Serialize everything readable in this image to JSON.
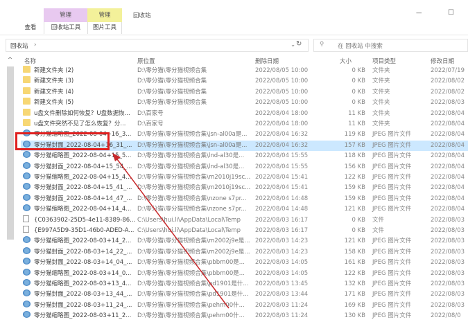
{
  "ribbon": {
    "context_tabs": [
      "管理",
      "管理"
    ],
    "window_title": "回收站",
    "tabs": [
      "查看",
      "回收站工具",
      "图片工具"
    ],
    "minimize": "—",
    "maximize": "☐"
  },
  "address": {
    "path": "回收站",
    "separator": "›",
    "search_placeholder": "在 回收站 中搜索"
  },
  "columns": [
    "名称",
    "原位置",
    "删除日期",
    "大小",
    "项目类型",
    "修改日期"
  ],
  "rows": [
    {
      "icon": "folder",
      "name": "新建文件夹 (2)",
      "loc": "D:\\零分猫\\零分猫视频合集",
      "del": "2022/08/05 10:00",
      "size": "0 KB",
      "type": "文件夹",
      "mod": "2022/07/19"
    },
    {
      "icon": "folder",
      "name": "新建文件夹 (3)",
      "loc": "D:\\零分猫\\零分猫视频合集",
      "del": "2022/08/05 10:00",
      "size": "0 KB",
      "type": "文件夹",
      "mod": "2022/08/02"
    },
    {
      "icon": "folder",
      "name": "新建文件夹 (4)",
      "loc": "D:\\零分猫\\零分猫视频合集",
      "del": "2022/08/05 10:00",
      "size": "0 KB",
      "type": "文件夹",
      "mod": "2022/08/02"
    },
    {
      "icon": "folder",
      "name": "新建文件夹 (5)",
      "loc": "D:\\零分猫\\零分猫视频合集",
      "del": "2022/08/05 10:00",
      "size": "0 KB",
      "type": "文件夹",
      "mod": "2022/08/03"
    },
    {
      "icon": "folder",
      "name": "u盘文件删除如何恢复？U盘数据恢...",
      "loc": "D:\\百家号",
      "del": "2022/08/04 18:00",
      "size": "11 KB",
      "type": "文件夹",
      "mod": "2022/08/04"
    },
    {
      "icon": "folder",
      "name": "u盘文件突然不见了怎么恢复？分...",
      "loc": "D:\\百家号",
      "del": "2022/08/04 18:00",
      "size": "11 KB",
      "type": "文件夹",
      "mod": "2022/08/04"
    },
    {
      "icon": "img",
      "name": "零分猫缩略图_2022-08-04+16_3...",
      "loc": "D:\\零分猫\\零分猫视频合集\\jsn-al00a是...",
      "del": "2022/08/04 16:32",
      "size": "119 KB",
      "type": "JPEG 图片文件",
      "mod": "2022/08/04"
    },
    {
      "icon": "img",
      "name": "零分猫封面_2022-08-04+16_31_...",
      "loc": "D:\\零分猫\\零分猫视频合集\\jsn-al00a是...",
      "del": "2022/08/04 16:32",
      "size": "157 KB",
      "type": "JPEG 图片文件",
      "mod": "2022/08/04"
    },
    {
      "icon": "img",
      "name": "零分猫缩略图_2022-08-04+15_5...",
      "loc": "D:\\零分猫\\零分猫视频合集\\lnd-al30是...",
      "del": "2022/08/04 15:55",
      "size": "118 KB",
      "type": "JPEG 图片文件",
      "mod": "2022/08/04"
    },
    {
      "icon": "img",
      "name": "零分猫封面_2022-08-04+15_54_...",
      "loc": "D:\\零分猫\\零分猫视频合集\\lnd-al30是...",
      "del": "2022/08/04 15:55",
      "size": "156 KB",
      "type": "JPEG 图片文件",
      "mod": "2022/08/04"
    },
    {
      "icon": "img",
      "name": "零分猫缩略图_2022-08-04+15_4...",
      "loc": "D:\\零分猫\\零分猫视频合集\\m2010j19sc...",
      "del": "2022/08/04 15:41",
      "size": "122 KB",
      "type": "JPEG 图片文件",
      "mod": "2022/08/04"
    },
    {
      "icon": "img",
      "name": "零分猫封面_2022-08-04+15_41_...",
      "loc": "D:\\零分猫\\零分猫视频合集\\m2010j19sc...",
      "del": "2022/08/04 15:41",
      "size": "159 KB",
      "type": "JPEG 图片文件",
      "mod": "2022/08/04"
    },
    {
      "icon": "img",
      "name": "零分猫封面_2022-08-04+14_47_...",
      "loc": "D:\\零分猫\\零分猫视频合集\\nzone s7pr...",
      "del": "2022/08/04 14:48",
      "size": "159 KB",
      "type": "JPEG 图片文件",
      "mod": "2022/08/04"
    },
    {
      "icon": "img",
      "name": "零分猫缩略图_2022-08-04+14_4...",
      "loc": "D:\\零分猫\\零分猫视频合集\\nzone s7pr...",
      "del": "2022/08/04 14:48",
      "size": "121 KB",
      "type": "JPEG 图片文件",
      "mod": "2022/08/04"
    },
    {
      "icon": "file",
      "name": "{C0363902-25D5-4e11-8389-86...",
      "loc": "C:\\Users\\hui.li\\AppData\\Local\\Temp",
      "del": "2022/08/03 16:17",
      "size": "0 KB",
      "type": "文件",
      "mod": "2022/08/03"
    },
    {
      "icon": "file",
      "name": "{E997A5D9-35D1-46b0-ADED-A...",
      "loc": "C:\\Users\\hui.li\\AppData\\Local\\Temp",
      "del": "2022/08/03 16:17",
      "size": "0 KB",
      "type": "文件",
      "mod": "2022/08/03"
    },
    {
      "icon": "img",
      "name": "零分猫缩略图_2022-08-03+14_2...",
      "loc": "D:\\零分猫\\零分猫视频合集\\m2002j9e是...",
      "del": "2022/08/03 14:23",
      "size": "121 KB",
      "type": "JPEG 图片文件",
      "mod": "2022/08/03"
    },
    {
      "icon": "img",
      "name": "零分猫封面_2022-08-03+14_22_...",
      "loc": "D:\\零分猫\\零分猫视频合集\\m2002j9e是...",
      "del": "2022/08/03 14:23",
      "size": "158 KB",
      "type": "JPEG 图片文件",
      "mod": "2022/08/03"
    },
    {
      "icon": "img",
      "name": "零分猫封面_2022-08-03+14_04_...",
      "loc": "D:\\零分猫\\零分猫视频合集\\pbbm00是...",
      "del": "2022/08/03 14:05",
      "size": "161 KB",
      "type": "JPEG 图片文件",
      "mod": "2022/08/03"
    },
    {
      "icon": "img",
      "name": "零分猫缩略图_2022-08-03+14_0...",
      "loc": "D:\\零分猫\\零分猫视频合集\\pbbm00是...",
      "del": "2022/08/03 14:05",
      "size": "122 KB",
      "type": "JPEG 图片文件",
      "mod": "2022/08/03"
    },
    {
      "icon": "img",
      "name": "零分猫缩略图_2022-08-03+13_4...",
      "loc": "D:\\零分猫\\零分猫视频合集\\pd1901是什...",
      "del": "2022/08/03 13:45",
      "size": "132 KB",
      "type": "JPEG 图片文件",
      "mod": "2022/08/03"
    },
    {
      "icon": "img",
      "name": "零分猫封面_2022-08-03+13_44_...",
      "loc": "D:\\零分猫\\零分猫视频合集\\pd1901是什...",
      "del": "2022/08/03 13:44",
      "size": "171 KB",
      "type": "JPEG 图片文件",
      "mod": "2022/08/03"
    },
    {
      "icon": "img",
      "name": "零分猫封面_2022-08-03+11_24_...",
      "loc": "D:\\零分猫\\零分猫视频合集\\pehm00什...",
      "del": "2022/08/03 11:24",
      "size": "169 KB",
      "type": "JPEG 图片文件",
      "mod": "2022/08/03"
    },
    {
      "icon": "img",
      "name": "零分猫缩略图_2022-08-03+11_2...",
      "loc": "D:\\零分猫\\零分猫视频合集\\pehm00什...",
      "del": "2022/08/03 11:24",
      "size": "130 KB",
      "type": "JPEG 图片文件",
      "mod": "2022/08/0"
    }
  ],
  "selected_index": 7,
  "colors": {
    "manage_purple": "#e8c9f0",
    "manage_yellow": "#f3f19a",
    "selection": "#cce8ff",
    "highlight_red": "#e0201f"
  }
}
